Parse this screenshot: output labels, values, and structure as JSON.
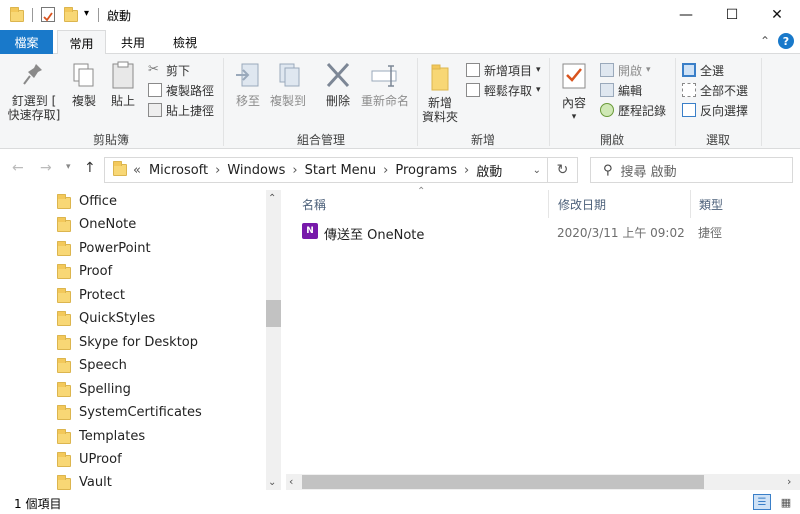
{
  "window": {
    "title": "啟動",
    "minimize_glyph": "—",
    "maximize_glyph": "☐",
    "close_glyph": "✕"
  },
  "ribbon_tabs": [
    "檔案",
    "常用",
    "共用",
    "檢視"
  ],
  "ribbon": {
    "clipboard": {
      "pin_label_1": "釘選到 [",
      "pin_label_2": "快速存取]",
      "copy_label": "複製",
      "paste_label": "貼上",
      "cut_label": "剪下",
      "copy_path_label": "複製路徑",
      "paste_shortcut_label": "貼上捷徑",
      "group_label": "剪貼簿"
    },
    "organize": {
      "move_to_label": "移至",
      "copy_to_label": "複製到",
      "delete_label": "刪除",
      "rename_label": "重新命名",
      "group_label": "組合管理"
    },
    "new": {
      "new_folder_label_1": "新增",
      "new_folder_label_2": "資料夾",
      "new_item_label": "新增項目",
      "easy_access_label": "輕鬆存取",
      "group_label": "新增"
    },
    "open": {
      "properties_label": "內容",
      "open_label": "開啟",
      "edit_label": "編輯",
      "history_label": "歷程記錄",
      "group_label": "開啟"
    },
    "select": {
      "select_all_label": "全選",
      "select_none_label": "全部不選",
      "invert_label": "反向選擇",
      "group_label": "選取"
    }
  },
  "address": {
    "prefix": "«",
    "path": [
      "Microsoft",
      "Windows",
      "Start Menu",
      "Programs",
      "啟動"
    ],
    "separator": "›",
    "search_placeholder": "搜尋 啟動"
  },
  "nav_tree": [
    "Office",
    "OneNote",
    "PowerPoint",
    "Proof",
    "Protect",
    "QuickStyles",
    "Skype for Desktop",
    "Speech",
    "Spelling",
    "SystemCertificates",
    "Templates",
    "UProof",
    "Vault"
  ],
  "columns": {
    "name": "名稱",
    "date": "修改日期",
    "type": "類型"
  },
  "files": [
    {
      "name": "傳送至 OneNote",
      "date": "2020/3/11 上午 09:02",
      "type": "捷徑"
    }
  ],
  "status": {
    "count": "1 個項目"
  },
  "colors": {
    "file_tab": "#1979ca",
    "folder": "#f8d775",
    "onenote": "#7719aa",
    "ribbon_bg": "#f5f6f7"
  }
}
